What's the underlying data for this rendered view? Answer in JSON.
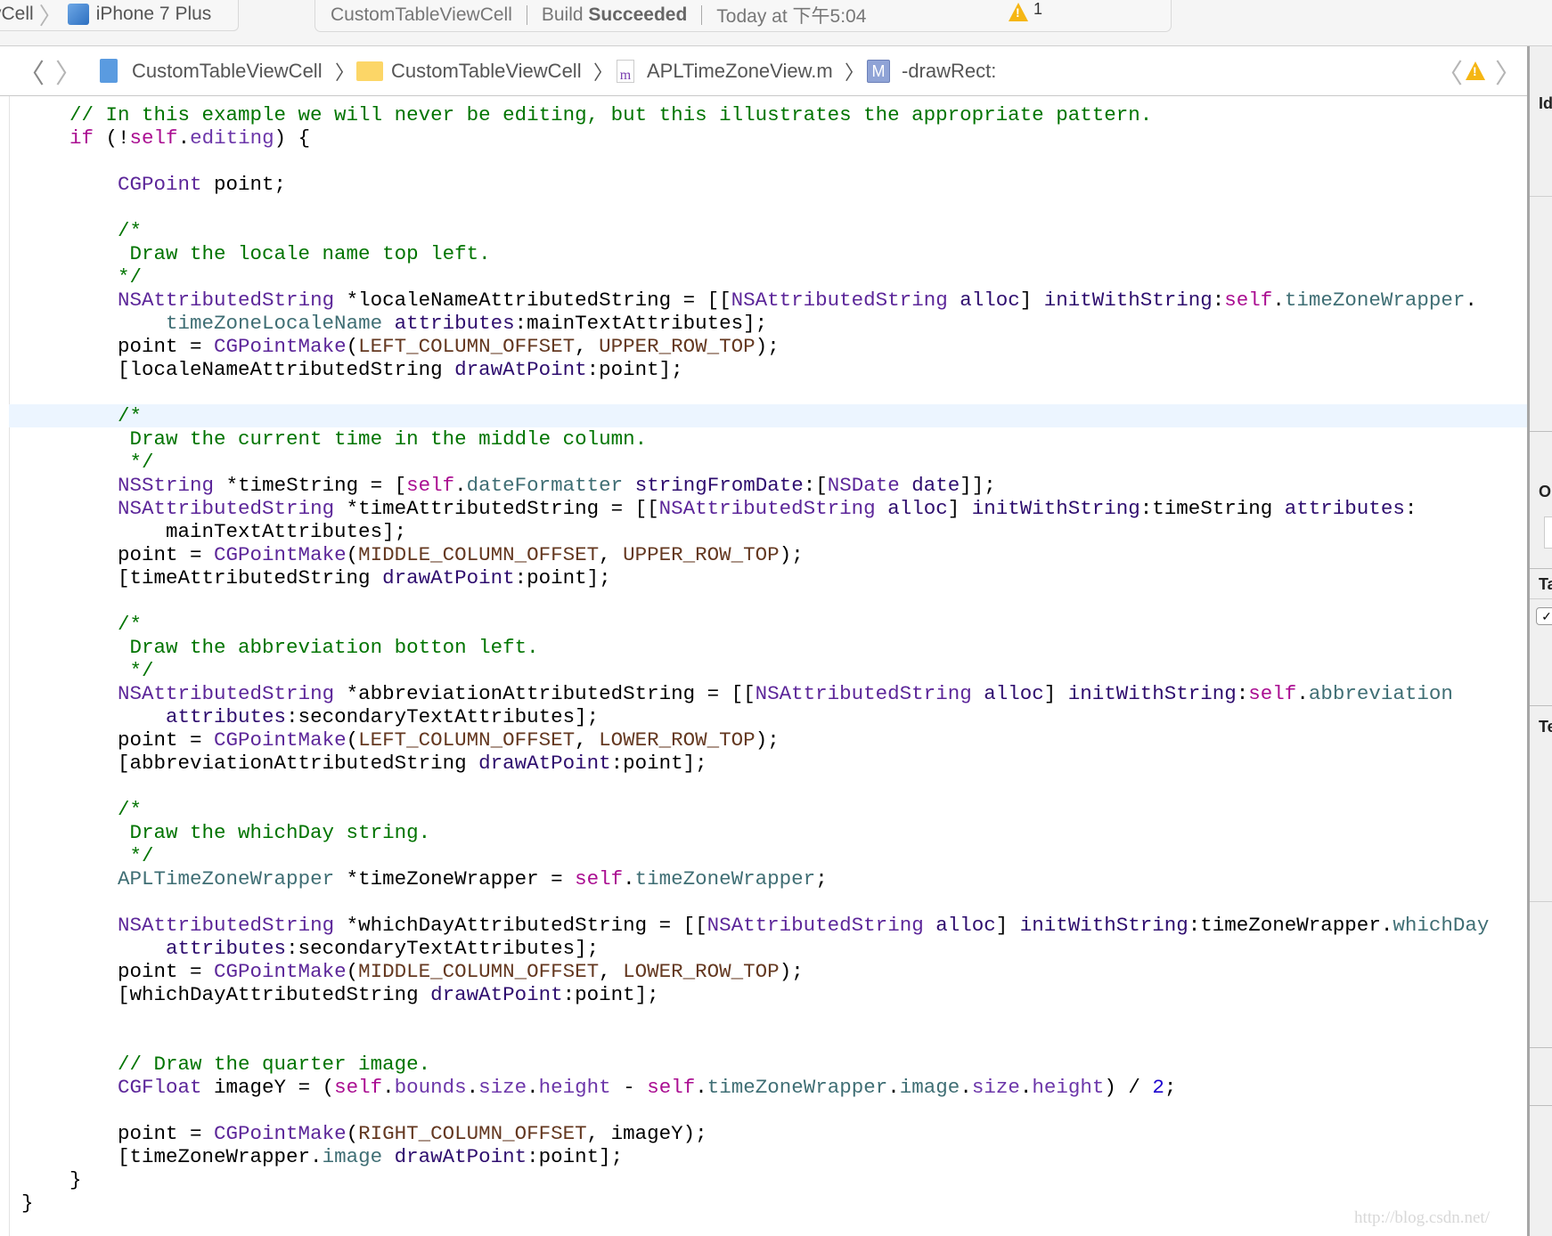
{
  "toolbar": {
    "scheme_target": "vCell",
    "device": "iPhone 7 Plus",
    "activity_project": "CustomTableViewCell",
    "build_prefix": "Build ",
    "build_status": "Succeeded",
    "timestamp": "Today at 下午5:04",
    "warning_count": "1"
  },
  "breadcrumb": {
    "project": "CustomTableViewCell",
    "group": "CustomTableViewCell",
    "file_icon_letter": "m",
    "file": "APLTimeZoneView.m",
    "method_icon_letter": "M",
    "method": "-drawRect:"
  },
  "inspector": {
    "sections": [
      "Id",
      "O",
      "Ta",
      "Te"
    ]
  },
  "watermark": "http://blog.csdn.net/",
  "colors": {
    "comment": "#007400",
    "keyword": "#aa0d91",
    "type": "#5c2699",
    "method": "#2e0d6e",
    "property": "#3f6e74",
    "macro": "#643820",
    "number": "#1c00cf",
    "current_line": "#ecf5ff"
  },
  "code": {
    "highlighted_line_index": 13,
    "lines": [
      [
        [
          "    // In this example we will never be editing, but this illustrates the appropriate pattern.",
          "c"
        ]
      ],
      [
        [
          "    ",
          "p"
        ],
        [
          "if",
          "k"
        ],
        [
          " (!",
          "p"
        ],
        [
          "self",
          "k"
        ],
        [
          ".",
          "p"
        ],
        [
          "editing",
          "s"
        ],
        [
          ") {",
          "p"
        ]
      ],
      [],
      [
        [
          "        ",
          "p"
        ],
        [
          "CGPoint",
          "t"
        ],
        [
          " point;",
          "p"
        ]
      ],
      [],
      [
        [
          "        /*",
          "c"
        ]
      ],
      [
        [
          "         Draw the locale name top left.",
          "c"
        ]
      ],
      [
        [
          "        */",
          "c"
        ]
      ],
      [
        [
          "        ",
          "p"
        ],
        [
          "NSAttributedString",
          "t"
        ],
        [
          " *localeNameAttributedString = [[",
          "p"
        ],
        [
          "NSAttributedString",
          "t"
        ],
        [
          " ",
          "p"
        ],
        [
          "alloc",
          "m"
        ],
        [
          "] ",
          "p"
        ],
        [
          "initWithString",
          "m"
        ],
        [
          ":",
          "p"
        ],
        [
          "self",
          "k"
        ],
        [
          ".",
          "p"
        ],
        [
          "timeZoneWrapper",
          "v"
        ],
        [
          ".",
          "p"
        ]
      ],
      [
        [
          "            ",
          "p"
        ],
        [
          "timeZoneLocaleName",
          "v"
        ],
        [
          " ",
          "p"
        ],
        [
          "attributes",
          "m"
        ],
        [
          ":mainTextAttributes];",
          "p"
        ]
      ],
      [
        [
          "        point = ",
          "p"
        ],
        [
          "CGPointMake",
          "t"
        ],
        [
          "(",
          "p"
        ],
        [
          "LEFT_COLUMN_OFFSET",
          "d"
        ],
        [
          ", ",
          "p"
        ],
        [
          "UPPER_ROW_TOP",
          "d"
        ],
        [
          ");",
          "p"
        ]
      ],
      [
        [
          "        [localeNameAttributedString ",
          "p"
        ],
        [
          "drawAtPoint",
          "m"
        ],
        [
          ":point];",
          "p"
        ]
      ],
      [],
      [
        [
          "        /*",
          "c"
        ]
      ],
      [
        [
          "         Draw the current time in the middle column.",
          "c"
        ]
      ],
      [
        [
          "         */",
          "c"
        ]
      ],
      [
        [
          "        ",
          "p"
        ],
        [
          "NSString",
          "t"
        ],
        [
          " *timeString = [",
          "p"
        ],
        [
          "self",
          "k"
        ],
        [
          ".",
          "p"
        ],
        [
          "dateFormatter",
          "v"
        ],
        [
          " ",
          "p"
        ],
        [
          "stringFromDate",
          "m"
        ],
        [
          ":[",
          "p"
        ],
        [
          "NSDate",
          "t"
        ],
        [
          " ",
          "p"
        ],
        [
          "date",
          "m"
        ],
        [
          "]];",
          "p"
        ]
      ],
      [
        [
          "        ",
          "p"
        ],
        [
          "NSAttributedString",
          "t"
        ],
        [
          " *timeAttributedString = [[",
          "p"
        ],
        [
          "NSAttributedString",
          "t"
        ],
        [
          " ",
          "p"
        ],
        [
          "alloc",
          "m"
        ],
        [
          "] ",
          "p"
        ],
        [
          "initWithString",
          "m"
        ],
        [
          ":timeString ",
          "p"
        ],
        [
          "attributes",
          "m"
        ],
        [
          ":",
          "p"
        ]
      ],
      [
        [
          "            mainTextAttributes];",
          "p"
        ]
      ],
      [
        [
          "        point = ",
          "p"
        ],
        [
          "CGPointMake",
          "t"
        ],
        [
          "(",
          "p"
        ],
        [
          "MIDDLE_COLUMN_OFFSET",
          "d"
        ],
        [
          ", ",
          "p"
        ],
        [
          "UPPER_ROW_TOP",
          "d"
        ],
        [
          ");",
          "p"
        ]
      ],
      [
        [
          "        [timeAttributedString ",
          "p"
        ],
        [
          "drawAtPoint",
          "m"
        ],
        [
          ":point];",
          "p"
        ]
      ],
      [],
      [
        [
          "        /*",
          "c"
        ]
      ],
      [
        [
          "         Draw the abbreviation botton left.",
          "c"
        ]
      ],
      [
        [
          "         */",
          "c"
        ]
      ],
      [
        [
          "        ",
          "p"
        ],
        [
          "NSAttributedString",
          "t"
        ],
        [
          " *abbreviationAttributedString = [[",
          "p"
        ],
        [
          "NSAttributedString",
          "t"
        ],
        [
          " ",
          "p"
        ],
        [
          "alloc",
          "m"
        ],
        [
          "] ",
          "p"
        ],
        [
          "initWithString",
          "m"
        ],
        [
          ":",
          "p"
        ],
        [
          "self",
          "k"
        ],
        [
          ".",
          "p"
        ],
        [
          "abbreviation",
          "v"
        ]
      ],
      [
        [
          "            ",
          "p"
        ],
        [
          "attributes",
          "m"
        ],
        [
          ":secondaryTextAttributes];",
          "p"
        ]
      ],
      [
        [
          "        point = ",
          "p"
        ],
        [
          "CGPointMake",
          "t"
        ],
        [
          "(",
          "p"
        ],
        [
          "LEFT_COLUMN_OFFSET",
          "d"
        ],
        [
          ", ",
          "p"
        ],
        [
          "LOWER_ROW_TOP",
          "d"
        ],
        [
          ");",
          "p"
        ]
      ],
      [
        [
          "        [abbreviationAttributedString ",
          "p"
        ],
        [
          "drawAtPoint",
          "m"
        ],
        [
          ":point];",
          "p"
        ]
      ],
      [],
      [
        [
          "        /*",
          "c"
        ]
      ],
      [
        [
          "         Draw the whichDay string.",
          "c"
        ]
      ],
      [
        [
          "         */",
          "c"
        ]
      ],
      [
        [
          "        ",
          "p"
        ],
        [
          "APLTimeZoneWrapper",
          "v"
        ],
        [
          " *timeZoneWrapper = ",
          "p"
        ],
        [
          "self",
          "k"
        ],
        [
          ".",
          "p"
        ],
        [
          "timeZoneWrapper",
          "v"
        ],
        [
          ";",
          "p"
        ]
      ],
      [],
      [
        [
          "        ",
          "p"
        ],
        [
          "NSAttributedString",
          "t"
        ],
        [
          " *whichDayAttributedString = [[",
          "p"
        ],
        [
          "NSAttributedString",
          "t"
        ],
        [
          " ",
          "p"
        ],
        [
          "alloc",
          "m"
        ],
        [
          "] ",
          "p"
        ],
        [
          "initWithString",
          "m"
        ],
        [
          ":timeZoneWrapper.",
          "p"
        ],
        [
          "whichDay",
          "v"
        ]
      ],
      [
        [
          "            ",
          "p"
        ],
        [
          "attributes",
          "m"
        ],
        [
          ":secondaryTextAttributes];",
          "p"
        ]
      ],
      [
        [
          "        point = ",
          "p"
        ],
        [
          "CGPointMake",
          "t"
        ],
        [
          "(",
          "p"
        ],
        [
          "MIDDLE_COLUMN_OFFSET",
          "d"
        ],
        [
          ", ",
          "p"
        ],
        [
          "LOWER_ROW_TOP",
          "d"
        ],
        [
          ");",
          "p"
        ]
      ],
      [
        [
          "        [whichDayAttributedString ",
          "p"
        ],
        [
          "drawAtPoint",
          "m"
        ],
        [
          ":point];",
          "p"
        ]
      ],
      [],
      [],
      [
        [
          "        // Draw the quarter image.",
          "c"
        ]
      ],
      [
        [
          "        ",
          "p"
        ],
        [
          "CGFloat",
          "t"
        ],
        [
          " imageY = (",
          "p"
        ],
        [
          "self",
          "k"
        ],
        [
          ".",
          "p"
        ],
        [
          "bounds",
          "s"
        ],
        [
          ".",
          "p"
        ],
        [
          "size",
          "s"
        ],
        [
          ".",
          "p"
        ],
        [
          "height",
          "s"
        ],
        [
          " - ",
          "p"
        ],
        [
          "self",
          "k"
        ],
        [
          ".",
          "p"
        ],
        [
          "timeZoneWrapper",
          "v"
        ],
        [
          ".",
          "p"
        ],
        [
          "image",
          "v"
        ],
        [
          ".",
          "p"
        ],
        [
          "size",
          "s"
        ],
        [
          ".",
          "p"
        ],
        [
          "height",
          "s"
        ],
        [
          ") / ",
          "p"
        ],
        [
          "2",
          "n"
        ],
        [
          ";",
          "p"
        ]
      ],
      [],
      [
        [
          "        point = ",
          "p"
        ],
        [
          "CGPointMake",
          "t"
        ],
        [
          "(",
          "p"
        ],
        [
          "RIGHT_COLUMN_OFFSET",
          "d"
        ],
        [
          ", imageY);",
          "p"
        ]
      ],
      [
        [
          "        [timeZoneWrapper.",
          "p"
        ],
        [
          "image",
          "v"
        ],
        [
          " ",
          "p"
        ],
        [
          "drawAtPoint",
          "m"
        ],
        [
          ":point];",
          "p"
        ]
      ],
      [
        [
          "    }",
          "p"
        ]
      ],
      [
        [
          "}",
          "p"
        ]
      ]
    ]
  }
}
